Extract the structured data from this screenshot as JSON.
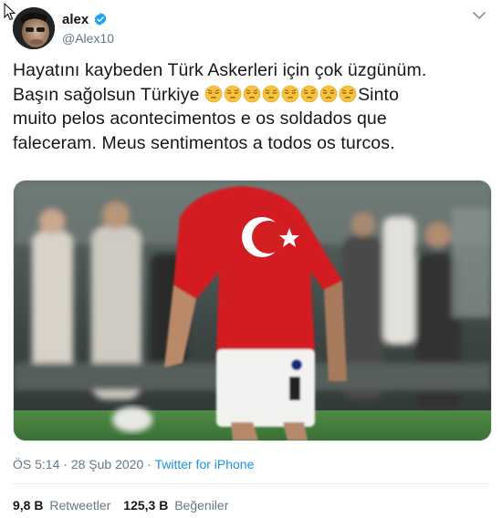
{
  "colors": {
    "accent": "#1da1f2",
    "text": "#14171a",
    "secondary": "#657786"
  },
  "author": {
    "display_name": "alex",
    "handle": "@Alex10",
    "verified": true
  },
  "tweet": {
    "line1": "Hayatını kaybeden Türk Askerleri için çok üzgünüm.",
    "line2_prefix": "Başın sağolsun Türkiye ",
    "emoji": "pensive-face",
    "emoji_count": 8,
    "line2_suffix": "Sinto",
    "line3": "muito pelos acontecimentos e os soldados que",
    "line4": "faleceram. Meus sentimentos a todos os turcos."
  },
  "meta": {
    "time": "ÖS 5:14",
    "separator": " · ",
    "date": "28 Şub 2020",
    "source": "Twitter for iPhone"
  },
  "stats": {
    "retweets_count": "9,8 B",
    "retweets_label": "Retweetler",
    "likes_count": "125,3 B",
    "likes_label": "Beğeniler"
  }
}
